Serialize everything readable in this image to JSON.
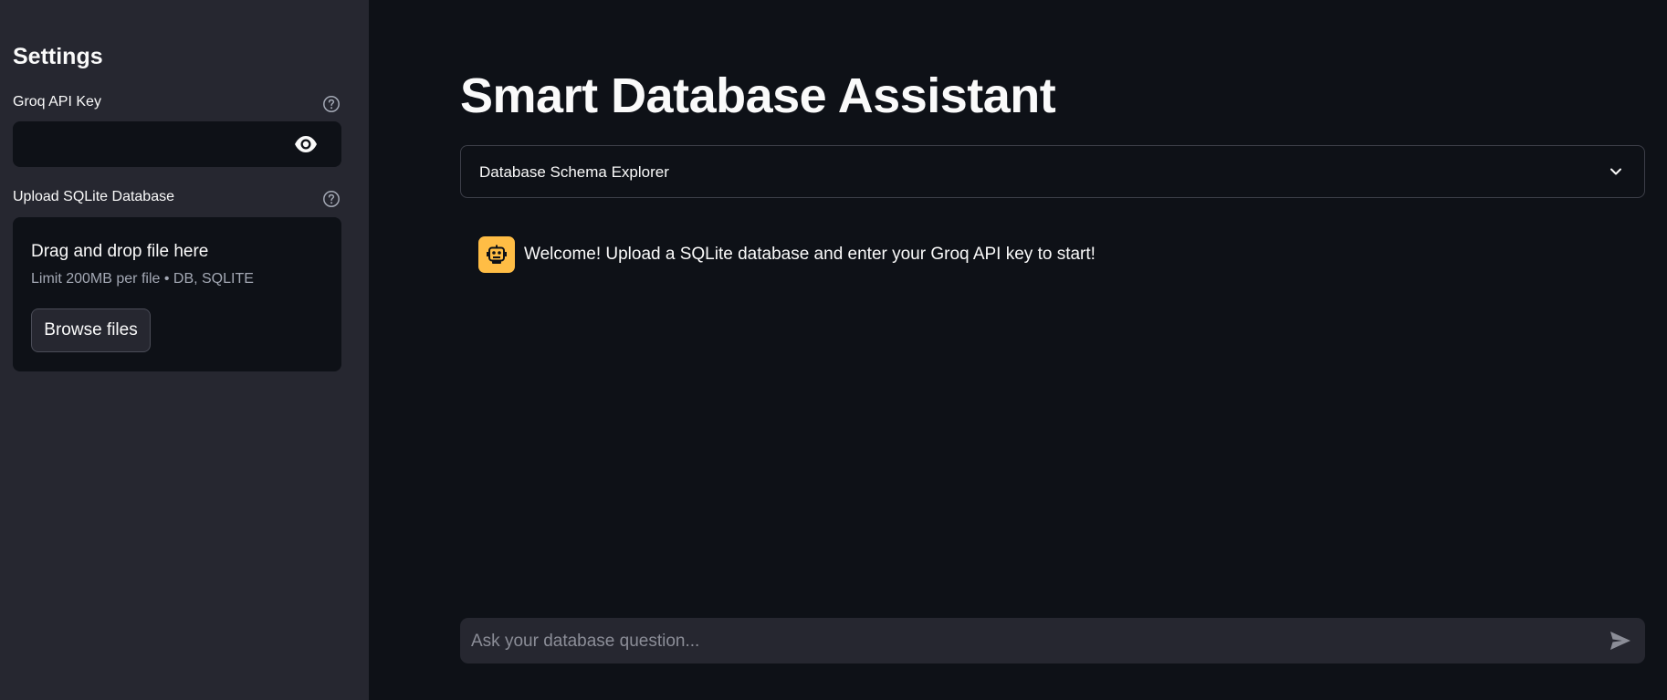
{
  "sidebar": {
    "title": "Settings",
    "api_key": {
      "label": "Groq API Key",
      "value": "",
      "toggle_icon": "eye-icon"
    },
    "upload": {
      "label": "Upload SQLite Database",
      "dropzone_title": "Drag and drop file here",
      "dropzone_limit": "Limit 200MB per file • DB, SQLITE",
      "browse_label": "Browse files"
    },
    "help_icon": "question-circle-icon"
  },
  "main": {
    "title": "Smart Database Assistant",
    "expander_label": "Database Schema Explorer",
    "messages": [
      {
        "role": "assistant",
        "avatar_icon": "robot-icon",
        "text": "Welcome! Upload a SQLite database and enter your Groq API key to start!"
      }
    ],
    "chat_input": {
      "placeholder": "Ask your database question...",
      "value": ""
    }
  },
  "colors": {
    "sidebar_bg": "#262730",
    "main_bg": "#0e1117",
    "avatar_bg": "#ffbd45",
    "text": "#fafafa",
    "muted_text": "#a3a8b4"
  }
}
